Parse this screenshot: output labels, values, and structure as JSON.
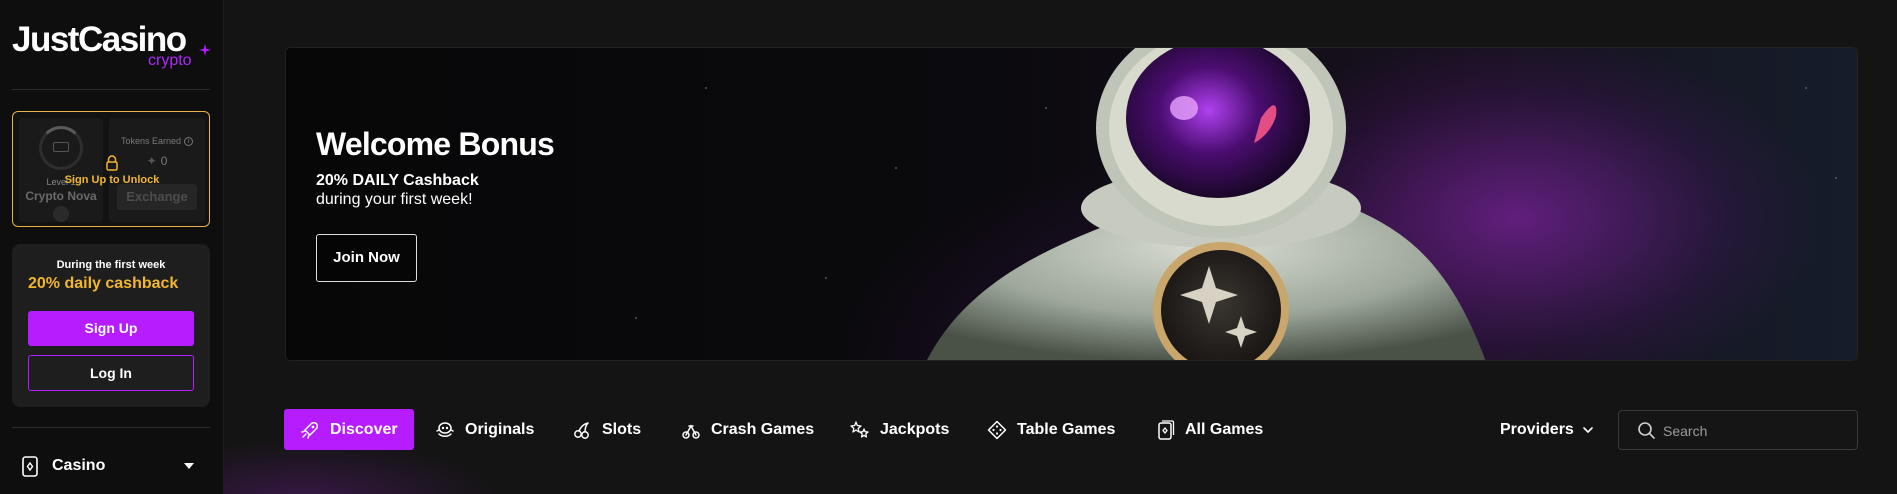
{
  "brand": {
    "name": "JustCasino",
    "sub": "crypto",
    "accent": "#b51cff",
    "gold": "#f2b630"
  },
  "sidebar": {
    "level_card": {
      "level": "Level 1",
      "tier": "Crypto Nova",
      "tokens_label": "Tokens Earned",
      "tokens_value": "0",
      "exchange_label": "Exchange",
      "unlock_text": "Sign Up to Unlock",
      "info_glyph": "i"
    },
    "promo": {
      "small": "During the first week",
      "big": "20% daily cashback",
      "signup": "Sign Up",
      "login": "Log In"
    },
    "nav": {
      "casino": "Casino"
    }
  },
  "banner": {
    "title": "Welcome Bonus",
    "line1": "20% DAILY Cashback",
    "line2": "during your first week!",
    "cta": "Join Now"
  },
  "categories": {
    "discover": "Discover",
    "originals": "Originals",
    "slots": "Slots",
    "crash": "Crash Games",
    "jackpots": "Jackpots",
    "table": "Table Games",
    "all": "All Games"
  },
  "toolbar": {
    "providers": "Providers",
    "search_placeholder": "Search"
  }
}
